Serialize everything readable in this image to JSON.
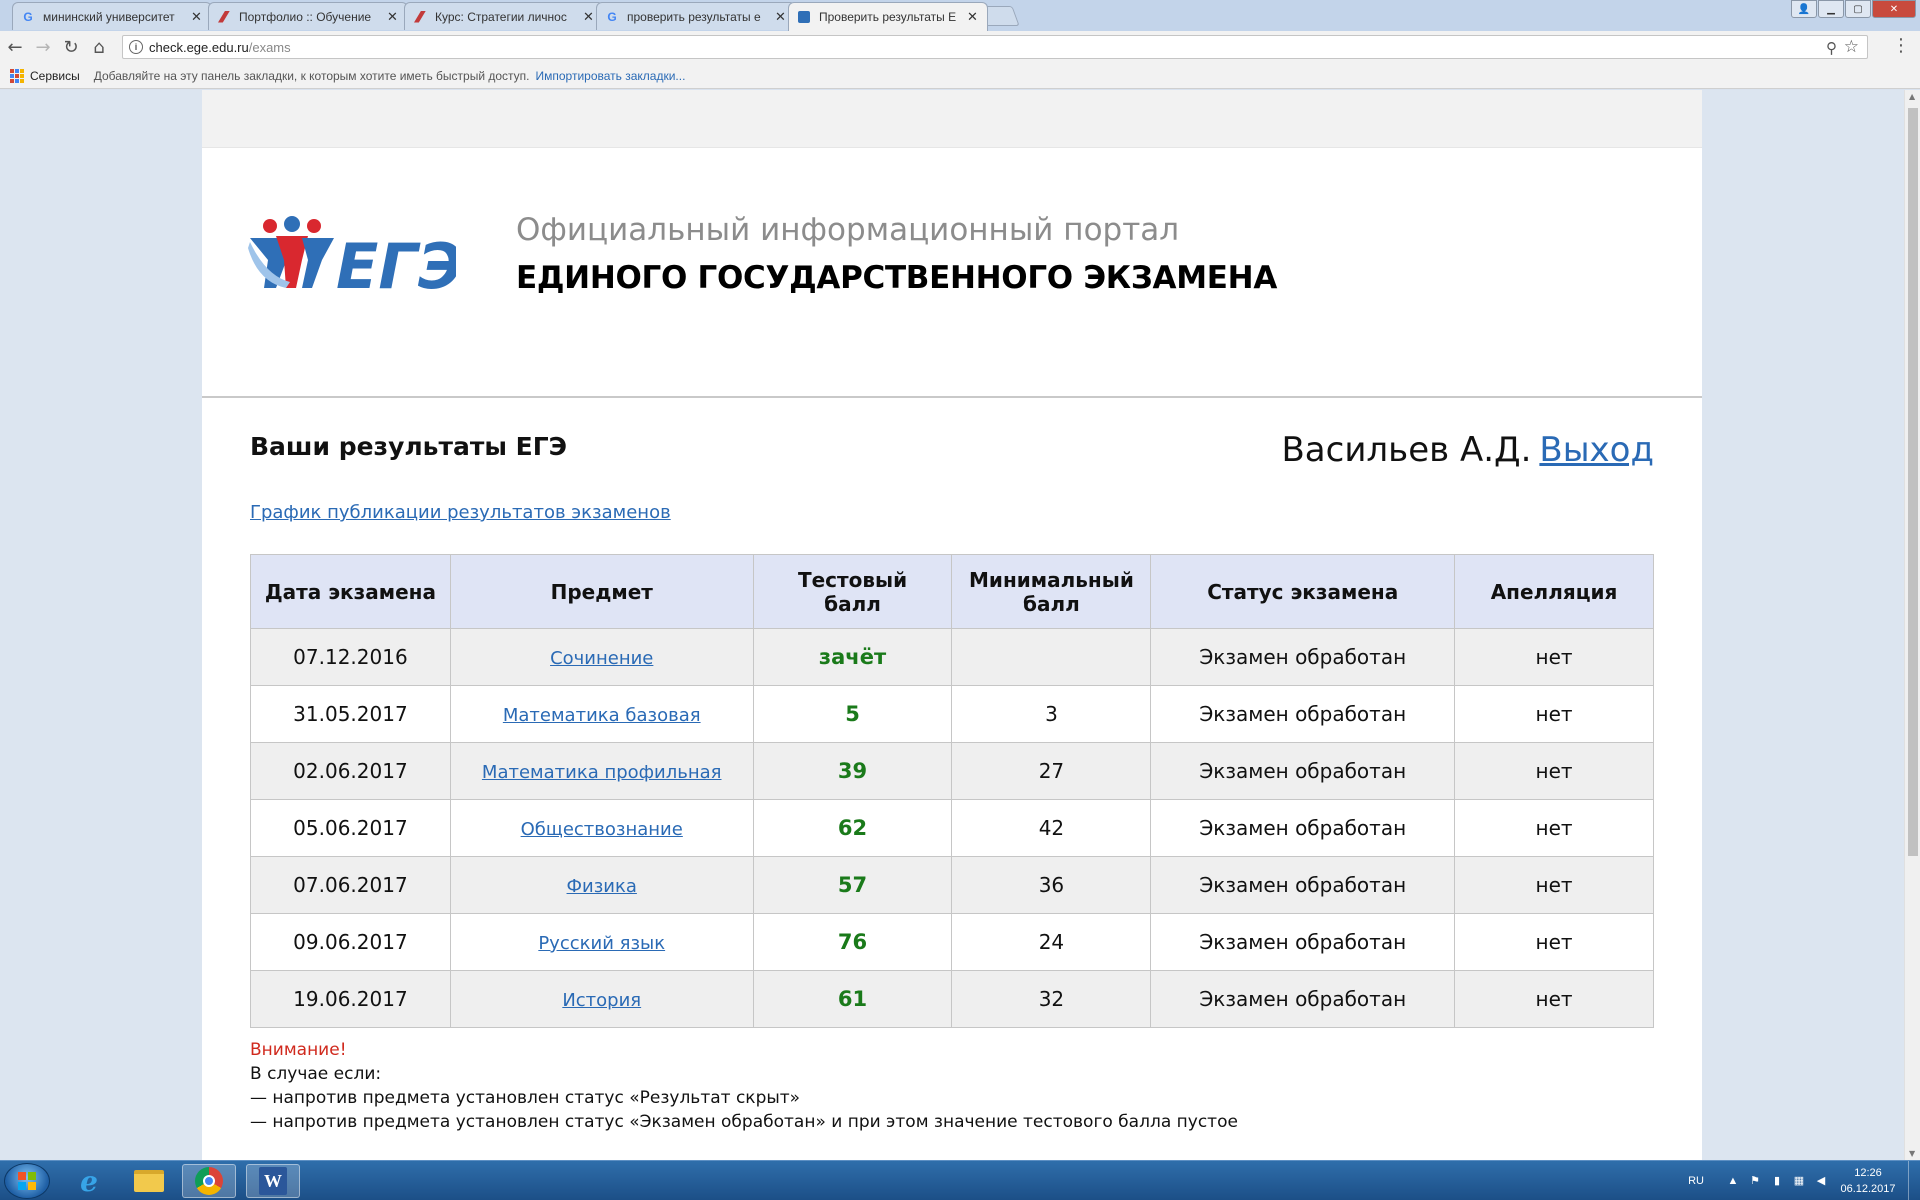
{
  "browser": {
    "tabs": [
      {
        "title": "мининский университет",
        "favicon": "google-icon"
      },
      {
        "title": "Портфолио :: Обучение",
        "favicon": "moodle-icon"
      },
      {
        "title": "Курс: Стратегии личнос",
        "favicon": "moodle-icon"
      },
      {
        "title": "проверить результаты е",
        "favicon": "google-icon"
      },
      {
        "title": "Проверить результаты Е",
        "favicon": "ege-icon",
        "active": true
      }
    ],
    "url_host": "check.ege.edu.ru",
    "url_path": "/exams",
    "bookmarks": {
      "apps_label": "Сервисы",
      "hint": "Добавляйте на эту панель закладки, к которым хотите иметь быстрый доступ.",
      "import_link": "Импортировать закладки..."
    }
  },
  "header": {
    "logo_text": "ЕГЭ",
    "portal_sub": "Официальный информационный портал",
    "portal_title": "ЕДИНОГО ГОСУДАРСТВЕННОГО ЭКЗАМЕНА"
  },
  "results": {
    "title": "Ваши результаты ЕГЭ",
    "user_name": "Васильев А.Д.",
    "logout": "Выход",
    "schedule_link": "График публикации результатов экзаменов",
    "columns": [
      "Дата экзамена",
      "Предмет",
      "Тестовый балл",
      "Минимальный балл",
      "Статус экзамена",
      "Апелляция"
    ],
    "rows": [
      {
        "date": "07.12.2016",
        "subject": "Сочинение",
        "score": "зачёт",
        "min": "",
        "status": "Экзамен обработан",
        "appeal": "нет"
      },
      {
        "date": "31.05.2017",
        "subject": "Математика базовая",
        "score": "5",
        "min": "3",
        "status": "Экзамен обработан",
        "appeal": "нет"
      },
      {
        "date": "02.06.2017",
        "subject": "Математика профильная",
        "score": "39",
        "min": "27",
        "status": "Экзамен обработан",
        "appeal": "нет"
      },
      {
        "date": "05.06.2017",
        "subject": "Обществознание",
        "score": "62",
        "min": "42",
        "status": "Экзамен обработан",
        "appeal": "нет"
      },
      {
        "date": "07.06.2017",
        "subject": "Физика",
        "score": "57",
        "min": "36",
        "status": "Экзамен обработан",
        "appeal": "нет"
      },
      {
        "date": "09.06.2017",
        "subject": "Русский язык",
        "score": "76",
        "min": "24",
        "status": "Экзамен обработан",
        "appeal": "нет"
      },
      {
        "date": "19.06.2017",
        "subject": "История",
        "score": "61",
        "min": "32",
        "status": "Экзамен обработан",
        "appeal": "нет"
      }
    ]
  },
  "notice": {
    "warning": "Внимание!",
    "lines": [
      "В случае если:",
      "— напротив предмета установлен статус «Результат скрыт»",
      "— напротив предмета установлен статус «Экзамен обработан» и при этом значение тестового балла пустое"
    ]
  },
  "taskbar": {
    "lang": "RU",
    "time": "12:26",
    "date": "06.12.2017"
  },
  "colors": {
    "link": "#2a6ab5",
    "score_green": "#1a7a1a",
    "warning_red": "#d0291d",
    "table_header": "#dfe4f5"
  }
}
